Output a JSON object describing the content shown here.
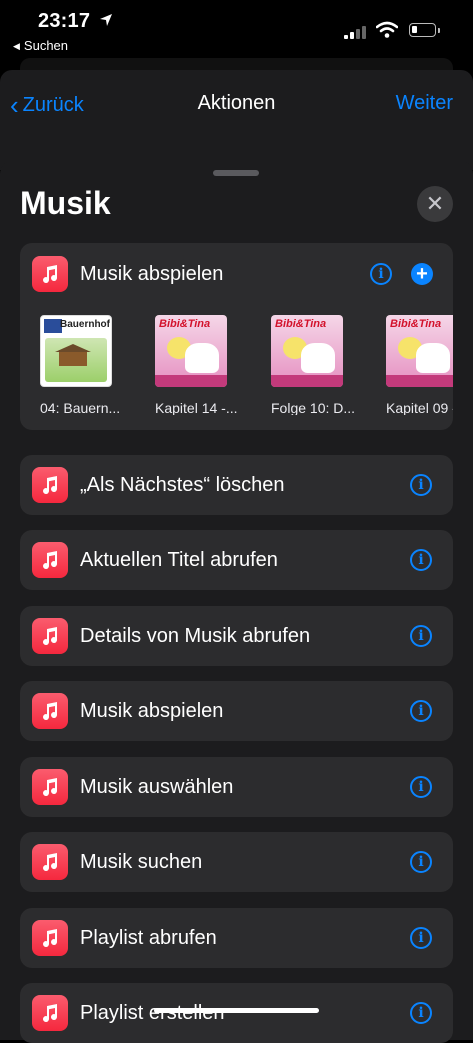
{
  "status": {
    "time": "23:17",
    "back_app": "Suchen"
  },
  "nav": {
    "back": "Zurück",
    "title": "Aktionen",
    "next": "Weiter"
  },
  "sheet": {
    "title": "Musik",
    "close": "✕"
  },
  "featured": {
    "label": "Musik abspielen",
    "albums": [
      {
        "caption": "04: Bauern...",
        "art_title": "Bauernhof"
      },
      {
        "caption": "Kapitel 14 -...",
        "art_title": "Bibi&Tina"
      },
      {
        "caption": "Folge 10: D...",
        "art_title": "Bibi&Tina"
      },
      {
        "caption": "Kapitel 09 -",
        "art_title": "Bibi&Tina"
      }
    ]
  },
  "actions": [
    {
      "label": "„Als Nächstes“ löschen"
    },
    {
      "label": "Aktuellen Titel abrufen"
    },
    {
      "label": "Details von Musik abrufen"
    },
    {
      "label": "Musik abspielen"
    },
    {
      "label": "Musik auswählen"
    },
    {
      "label": "Musik suchen"
    },
    {
      "label": "Playlist abrufen"
    },
    {
      "label": "Playlist erstellen"
    }
  ],
  "colors": {
    "accent": "#0a84ff",
    "music_icon": "#fa2d48",
    "card": "#2c2c2e",
    "sheet": "#1c1c1e"
  }
}
